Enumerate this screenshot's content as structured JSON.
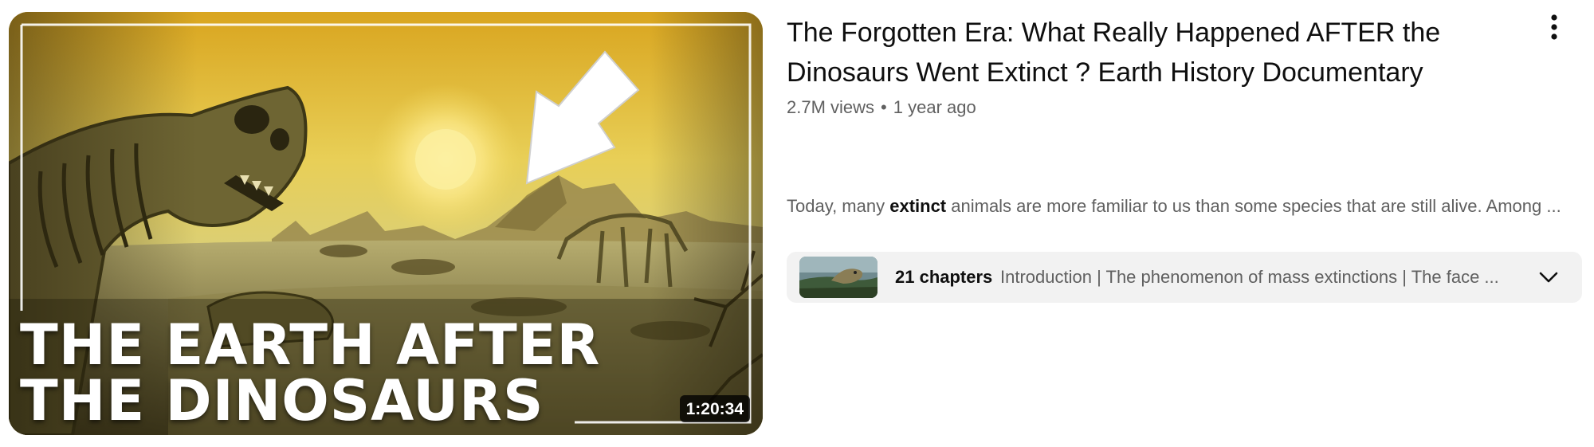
{
  "video": {
    "thumbnail_title_line1": "THE EARTH AFTER",
    "thumbnail_title_line2": "THE DINOSAURS",
    "duration": "1:20:34",
    "title": "The Forgotten Era: What Really Happened AFTER the Dinosaurs Went Extinct ? Earth History Documentary",
    "views": "2.7M views",
    "separator": "•",
    "age": "1 year ago",
    "snippet_before": "Today, many ",
    "snippet_highlight": "extinct",
    "snippet_after": " animals are more familiar to us than some species that are still alive. Among ...",
    "chapters_count": "21 chapters",
    "chapters_list": "Introduction | The phenomenon of mass extinctions | The face ..."
  },
  "icons": {
    "menu": "vertical-ellipsis-icon",
    "expand": "chevron-down-icon",
    "thumbnail_arrow": "arrow-icon"
  },
  "colors": {
    "title_text": "#0f0f0f",
    "secondary_text": "#606060",
    "chapters_bg": "#f2f2f2",
    "duration_bg": "#000000"
  }
}
